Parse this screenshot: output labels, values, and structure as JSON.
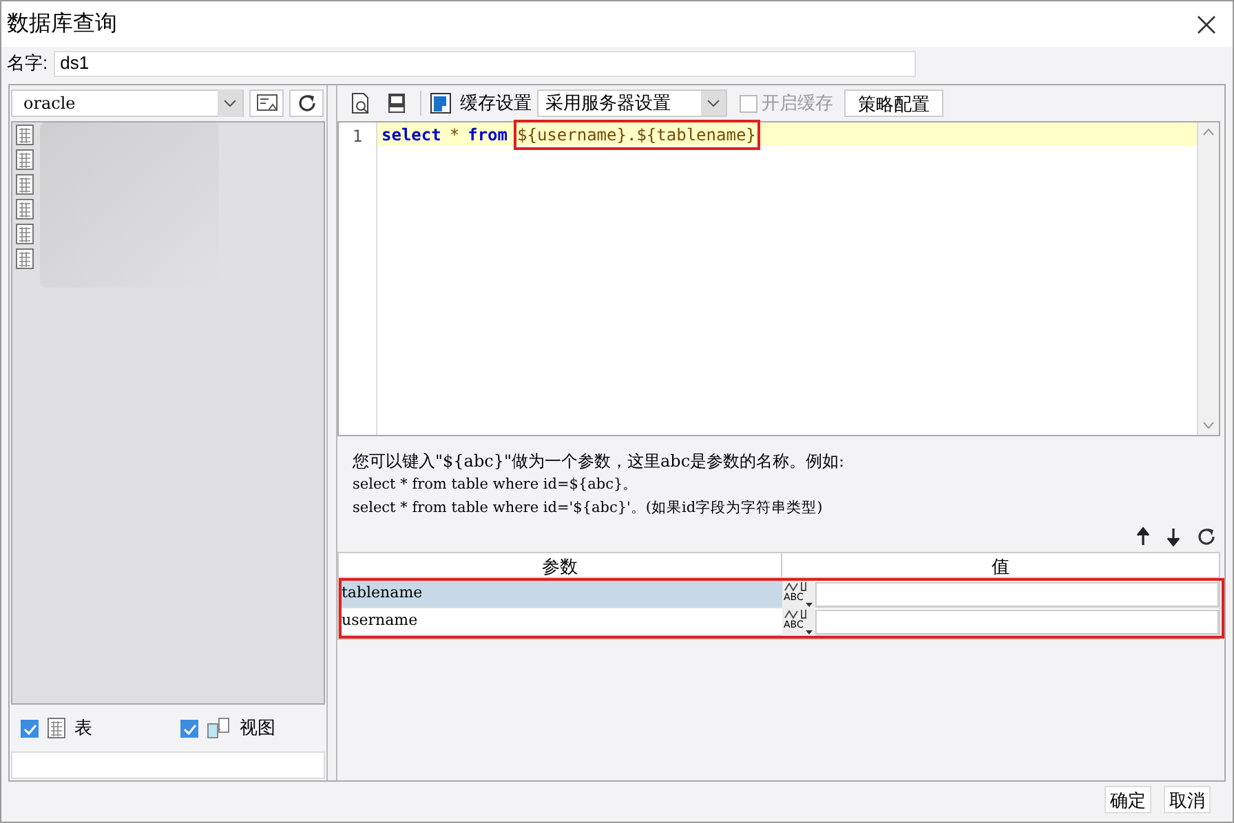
{
  "window": {
    "title": "数据库查询"
  },
  "name_field": {
    "label": "名字:",
    "value": "ds1"
  },
  "left_panel": {
    "database": "oracle",
    "filters": [
      {
        "label": "表",
        "checked": true,
        "kind": "table"
      },
      {
        "label": "视图",
        "checked": true,
        "kind": "view"
      }
    ]
  },
  "toolbar": {
    "cache_label": "缓存设置",
    "cache_select": "采用服务器设置",
    "enable_cache": {
      "label": "开启缓存",
      "checked": false,
      "disabled": true
    },
    "strategy_button": "策略配置"
  },
  "editor": {
    "line_number": "1",
    "tokens": [
      {
        "text": "select",
        "kind": "keyword"
      },
      {
        "text": "*",
        "kind": "operator"
      },
      {
        "text": "from",
        "kind": "keyword"
      },
      {
        "text": "${username}.${tablename}",
        "kind": "variable",
        "highlighted": true
      }
    ]
  },
  "hint": [
    "您可以键入\"${abc}\"做为一个参数，这里abc是参数的名称。例如:",
    "select * from table where id=${abc}。",
    "select * from table where id='${abc}'。(如果id字段为字符串类型)"
  ],
  "params": {
    "columns": [
      "参数",
      "值"
    ],
    "rows": [
      {
        "name": "tablename",
        "type": "ABC",
        "selected": true
      },
      {
        "name": "username",
        "type": "ABC",
        "selected": false
      }
    ]
  },
  "buttons": [
    "确定",
    "取消"
  ]
}
